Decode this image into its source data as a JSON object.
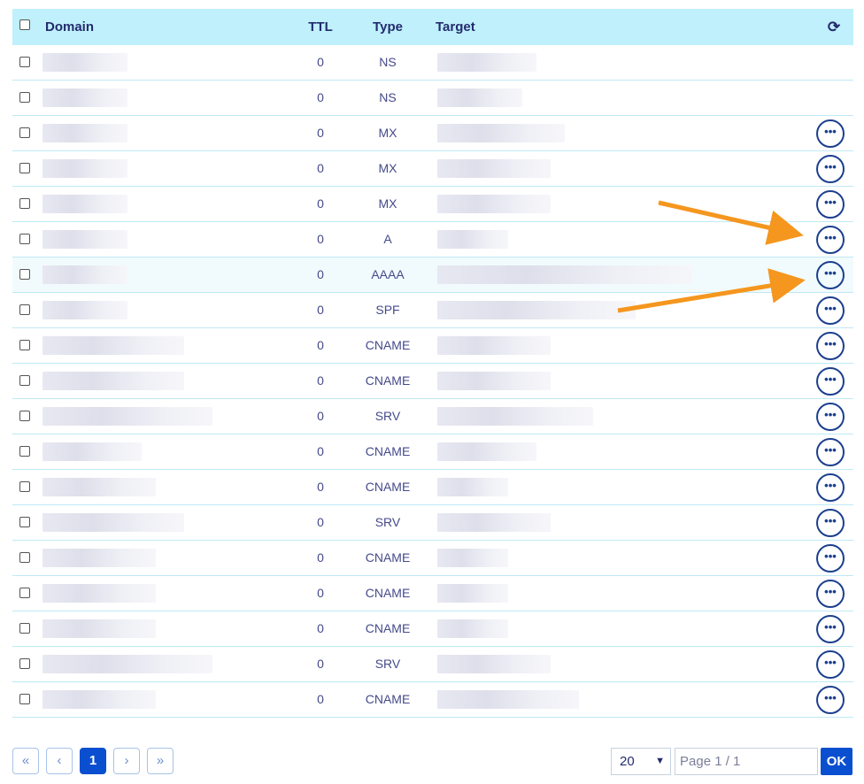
{
  "table": {
    "headers": {
      "domain": "Domain",
      "ttl": "TTL",
      "type": "Type",
      "target": "Target"
    },
    "refresh_icon": "refresh-icon",
    "more_icon": "ellipsis-icon",
    "rows": [
      {
        "ttl": "0",
        "type": "NS",
        "has_menu": false
      },
      {
        "ttl": "0",
        "type": "NS",
        "has_menu": false
      },
      {
        "ttl": "0",
        "type": "MX",
        "has_menu": true
      },
      {
        "ttl": "0",
        "type": "MX",
        "has_menu": true
      },
      {
        "ttl": "0",
        "type": "MX",
        "has_menu": true
      },
      {
        "ttl": "0",
        "type": "A",
        "has_menu": true
      },
      {
        "ttl": "0",
        "type": "AAAA",
        "has_menu": true
      },
      {
        "ttl": "0",
        "type": "SPF",
        "has_menu": true
      },
      {
        "ttl": "0",
        "type": "CNAME",
        "has_menu": true
      },
      {
        "ttl": "0",
        "type": "CNAME",
        "has_menu": true
      },
      {
        "ttl": "0",
        "type": "SRV",
        "has_menu": true
      },
      {
        "ttl": "0",
        "type": "CNAME",
        "has_menu": true
      },
      {
        "ttl": "0",
        "type": "CNAME",
        "has_menu": true
      },
      {
        "ttl": "0",
        "type": "SRV",
        "has_menu": true
      },
      {
        "ttl": "0",
        "type": "CNAME",
        "has_menu": true
      },
      {
        "ttl": "0",
        "type": "CNAME",
        "has_menu": true
      },
      {
        "ttl": "0",
        "type": "CNAME",
        "has_menu": true
      },
      {
        "ttl": "0",
        "type": "SRV",
        "has_menu": true
      },
      {
        "ttl": "0",
        "type": "CNAME",
        "has_menu": true
      }
    ]
  },
  "pagination": {
    "first": "«",
    "prev": "‹",
    "current": "1",
    "next": "›",
    "last": "»",
    "page_size": "20",
    "page_placeholder": "Page 1 / 1",
    "ok_label": "OK"
  },
  "colors": {
    "header_bg": "#bff0fc",
    "primary": "#0a4fcf",
    "arrow": "#f5961e"
  }
}
